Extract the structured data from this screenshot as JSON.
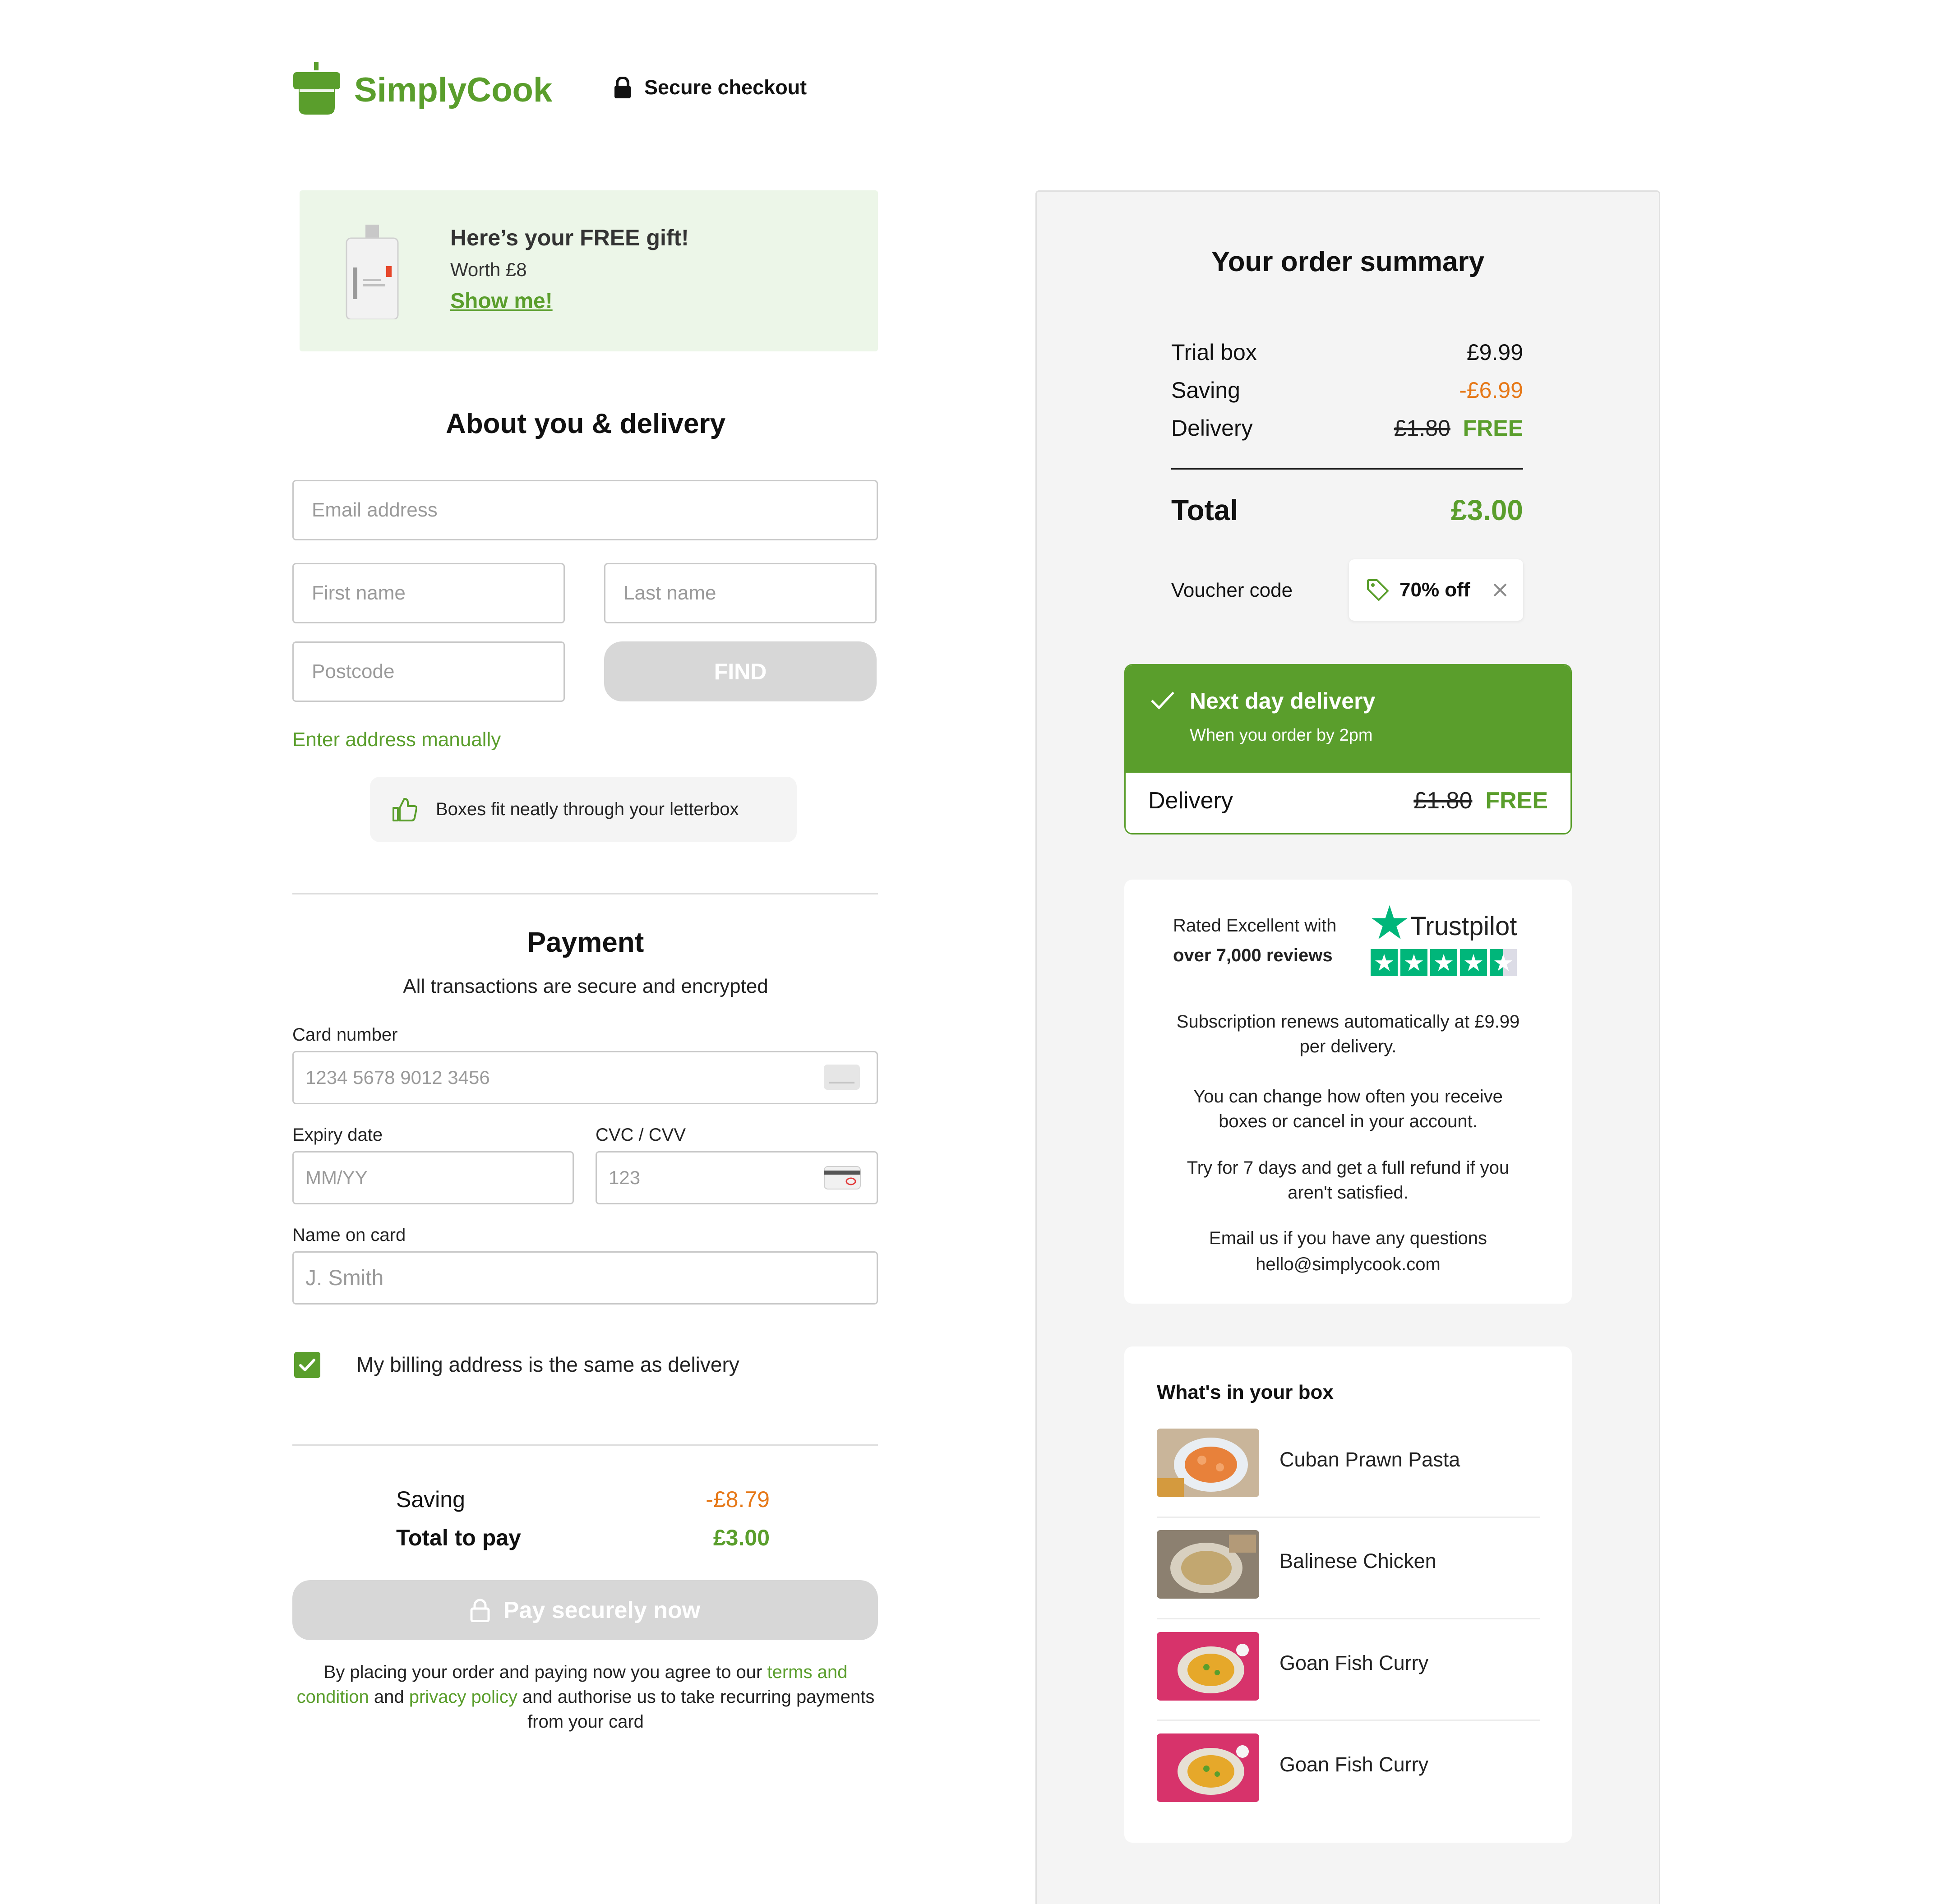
{
  "header": {
    "brand": "SimplyCook",
    "secure_label": "Secure checkout"
  },
  "gift": {
    "title": "Here’s your FREE gift!",
    "worth": "Worth £8",
    "link": "Show me!"
  },
  "delivery_form": {
    "heading": "About you & delivery",
    "email_placeholder": "Email address",
    "first_name_placeholder": "First name",
    "last_name_placeholder": "Last name",
    "postcode_placeholder": "Postcode",
    "find_label": "FIND",
    "manual_link": "Enter address manually",
    "letterbox_note": "Boxes fit neatly through your letterbox"
  },
  "payment": {
    "heading": "Payment",
    "subheading": "All transactions are secure and encrypted",
    "card_number_label": "Card number",
    "card_number_placeholder": "1234 5678 9012 3456",
    "expiry_label": "Expiry date",
    "expiry_placeholder": "MM/YY",
    "cvc_label": "CVC / CVV",
    "cvc_placeholder": "123",
    "name_label": "Name on card",
    "name_placeholder": "J. Smith",
    "billing_same_label": "My billing address is the same as delivery",
    "billing_same_checked": true,
    "saving_label": "Saving",
    "saving_value": "-£8.79",
    "total_label": "Total to pay",
    "total_value": "£3.00",
    "pay_button": "Pay securely now",
    "legal_prefix": "By placing your order and paying now you agree to our ",
    "terms_link": "terms and condition",
    "legal_and": " and ",
    "privacy_link": "privacy policy",
    "legal_suffix": " and authorise us to take recurring payments from your card"
  },
  "order_summary": {
    "title": "Your order summary",
    "rows": [
      {
        "label": "Trial box",
        "value": "£9.99"
      },
      {
        "label": "Saving",
        "value": "-£6.99"
      },
      {
        "label": "Delivery",
        "old_value": "£1.80",
        "value": "FREE"
      }
    ],
    "total_label": "Total",
    "total_value": "£3.00",
    "voucher_label": "Voucher code",
    "voucher_value": "70% off"
  },
  "next_day": {
    "title": "Next day delivery",
    "subtitle": "When you order by 2pm",
    "delivery_label": "Delivery",
    "old_price": "£1.80",
    "price": "FREE"
  },
  "trust": {
    "rated": "Rated Excellent with",
    "reviews": "over 7,000 reviews",
    "brand": "Trustpilot",
    "stars": 4.5,
    "p1": "Subscription renews automatically at £9.99 per delivery.",
    "p2": "You can change how often you receive boxes or cancel in your account.",
    "p3": "Try for 7 days and get a full refund if you aren't satisfied.",
    "p4": "Email us if you have any questions",
    "email": "hello@simplycook.com"
  },
  "box": {
    "title": "What's in your box",
    "items": [
      {
        "name": "Cuban Prawn Pasta"
      },
      {
        "name": "Balinese Chicken"
      },
      {
        "name": "Goan Fish Curry"
      },
      {
        "name": "Goan Fish Curry"
      }
    ]
  },
  "colors": {
    "brand_green": "#5a9e2c",
    "saving_orange": "#e67817",
    "disabled_grey": "#d7d7d7",
    "trustpilot_green": "#00b67a"
  }
}
